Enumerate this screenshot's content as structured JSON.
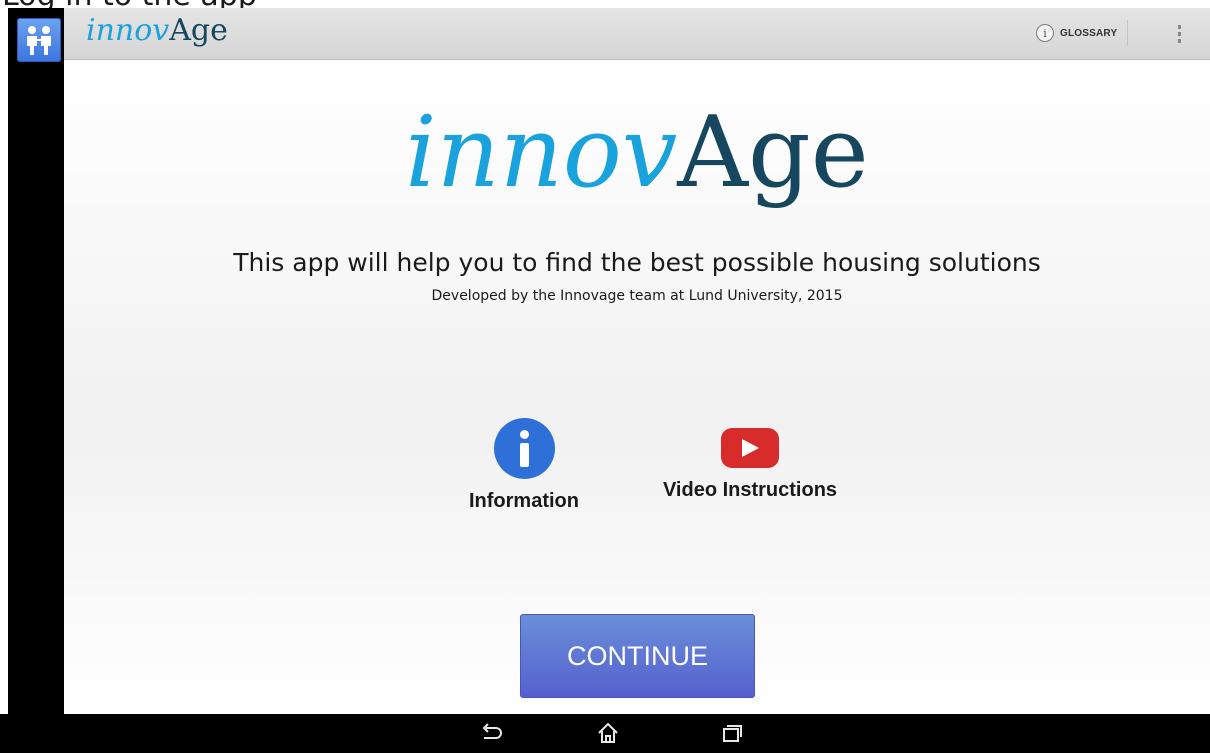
{
  "top_strip": {
    "text": "Log in to the app"
  },
  "action_bar": {
    "logo": {
      "italic_part": "innov",
      "upright_part": "Age"
    },
    "glossary": {
      "icon_glyph": "i",
      "label": "GLOSSARY"
    }
  },
  "hero": {
    "logo": {
      "italic_part": "innov",
      "upright_part": "Age"
    },
    "tagline": "This app will help you to find the best possible housing solutions",
    "credit": "Developed by the Innovage team at Lund University, 2015"
  },
  "features": {
    "information": {
      "label": "Information",
      "icon": "info-icon"
    },
    "video": {
      "label": "Video Instructions",
      "icon": "youtube-play-icon"
    }
  },
  "continue_button": {
    "label": "CONTINUE"
  },
  "icons": {
    "app": "two-people-icon",
    "overflow": "overflow-menu-icon",
    "back": "back-arrow-icon",
    "home": "home-icon",
    "recents": "recent-apps-icon"
  },
  "colors": {
    "logo_cyan": "#1aa2dc",
    "logo_navy": "#16475e",
    "info_blue": "#2f6fd8",
    "youtube_red": "#d82b2b",
    "button_blue": "#5a74d4"
  }
}
